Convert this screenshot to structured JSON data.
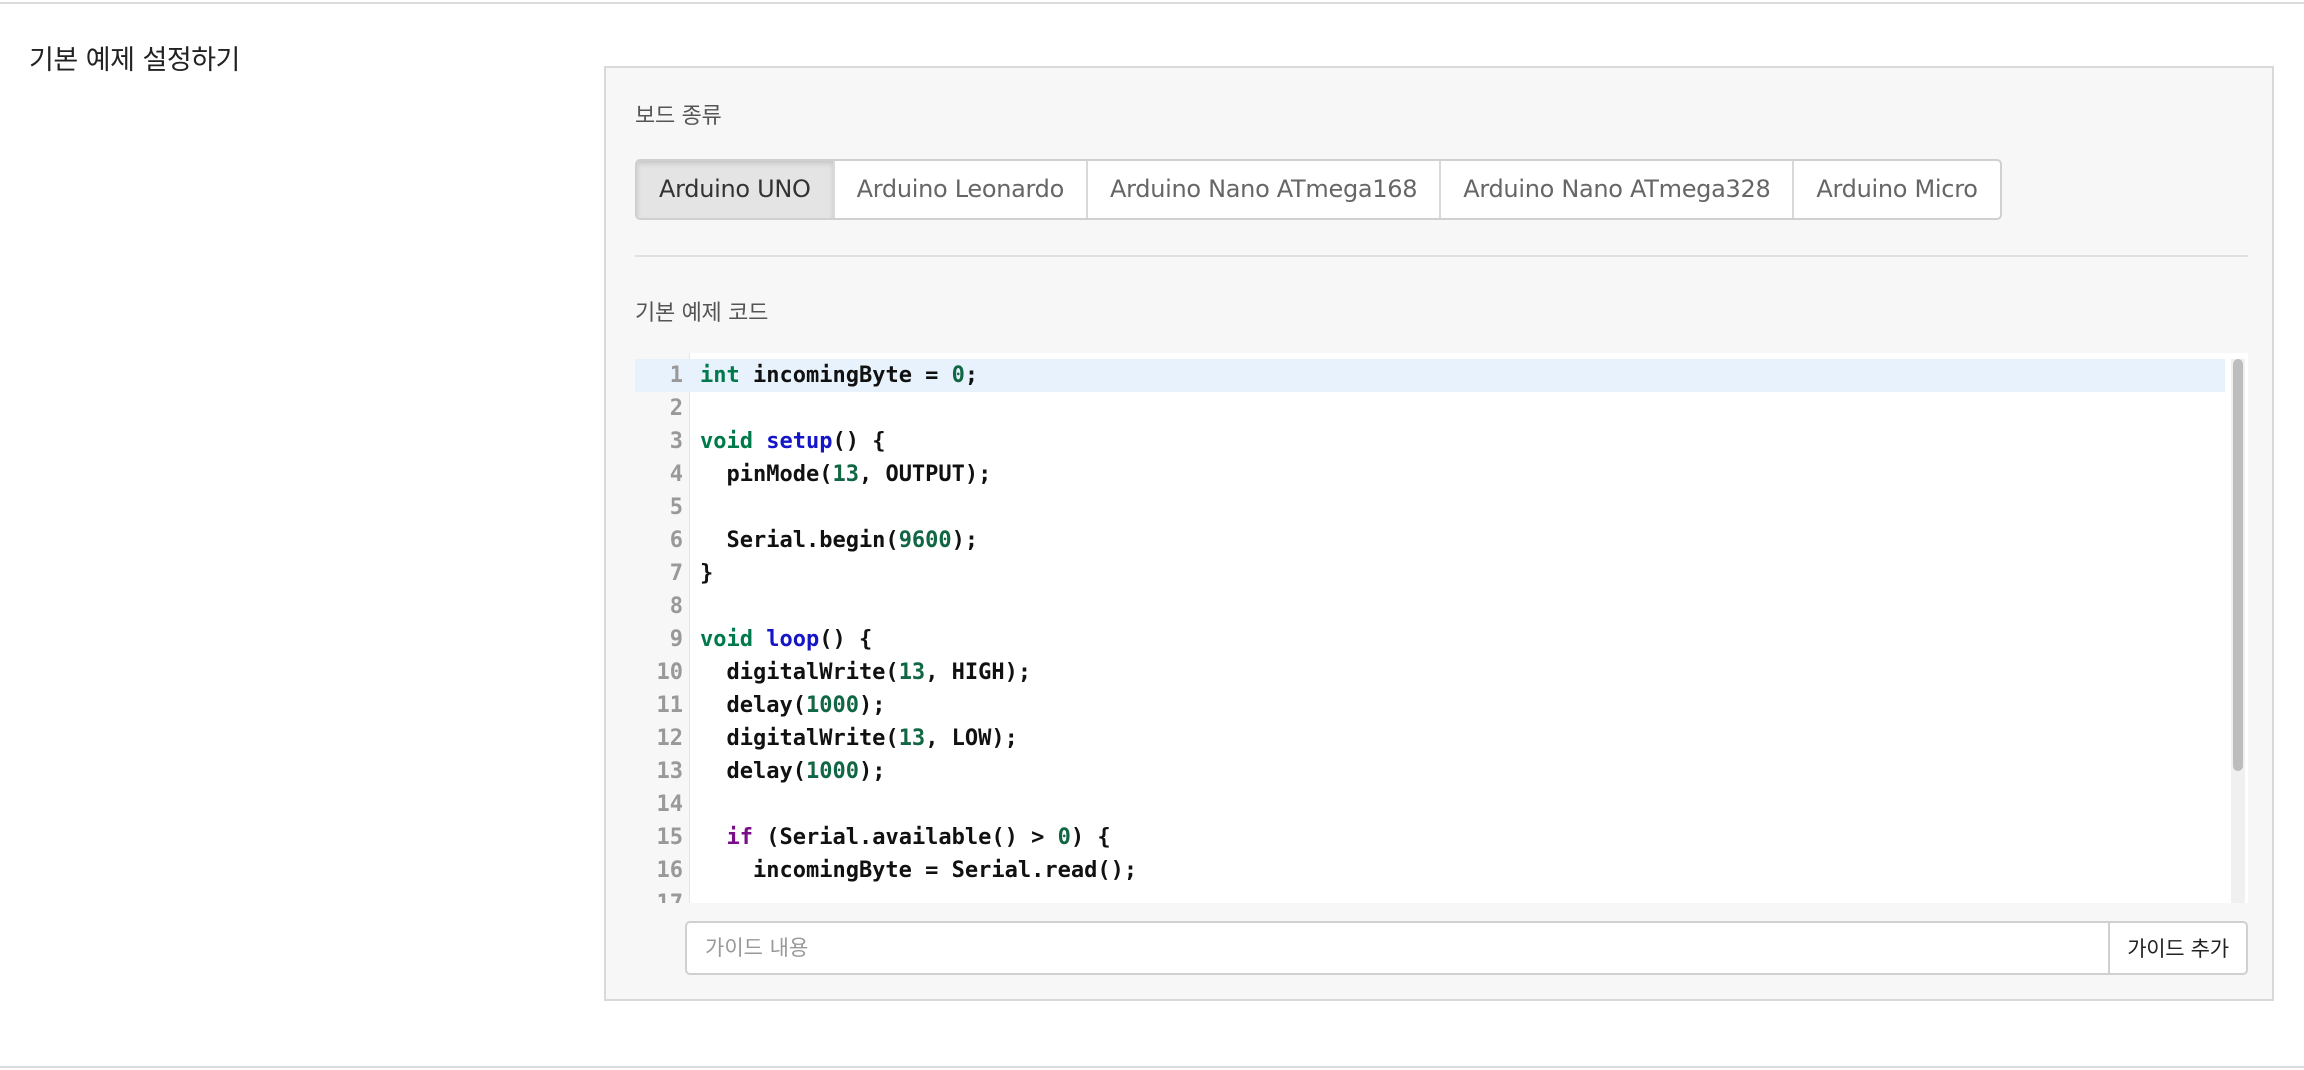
{
  "section": {
    "title": "기본 예제 설정하기"
  },
  "board": {
    "label": "보드 종류",
    "options": [
      "Arduino UNO",
      "Arduino Leonardo",
      "Arduino Nano ATmega168",
      "Arduino Nano ATmega328",
      "Arduino Micro"
    ],
    "selected": "Arduino UNO"
  },
  "code_editor": {
    "label": "기본 예제 코드",
    "current_line": 1,
    "lines": [
      {
        "n": "1",
        "text": "int incomingByte = 0;"
      },
      {
        "n": "2",
        "text": ""
      },
      {
        "n": "3",
        "text": "void setup() {"
      },
      {
        "n": "4",
        "text": "  pinMode(13, OUTPUT);"
      },
      {
        "n": "5",
        "text": ""
      },
      {
        "n": "6",
        "text": "  Serial.begin(9600);"
      },
      {
        "n": "7",
        "text": "}"
      },
      {
        "n": "8",
        "text": ""
      },
      {
        "n": "9",
        "text": "void loop() {"
      },
      {
        "n": "10",
        "text": "  digitalWrite(13, HIGH);"
      },
      {
        "n": "11",
        "text": "  delay(1000);"
      },
      {
        "n": "12",
        "text": "  digitalWrite(13, LOW);"
      },
      {
        "n": "13",
        "text": "  delay(1000);"
      },
      {
        "n": "14",
        "text": ""
      },
      {
        "n": "15",
        "text": "  if (Serial.available() > 0) {"
      },
      {
        "n": "16",
        "text": "    incomingByte = Serial.read();"
      },
      {
        "n": "17",
        "text": ""
      }
    ]
  },
  "guide": {
    "placeholder": "가이드 내용",
    "value": "",
    "add_label": "가이드 추가"
  },
  "colors": {
    "type_keyword": "#007a4a",
    "control_keyword": "#7a0d8a",
    "function_name": "#1414c8",
    "number": "#116644",
    "current_line_bg": "#e8f2fc"
  }
}
